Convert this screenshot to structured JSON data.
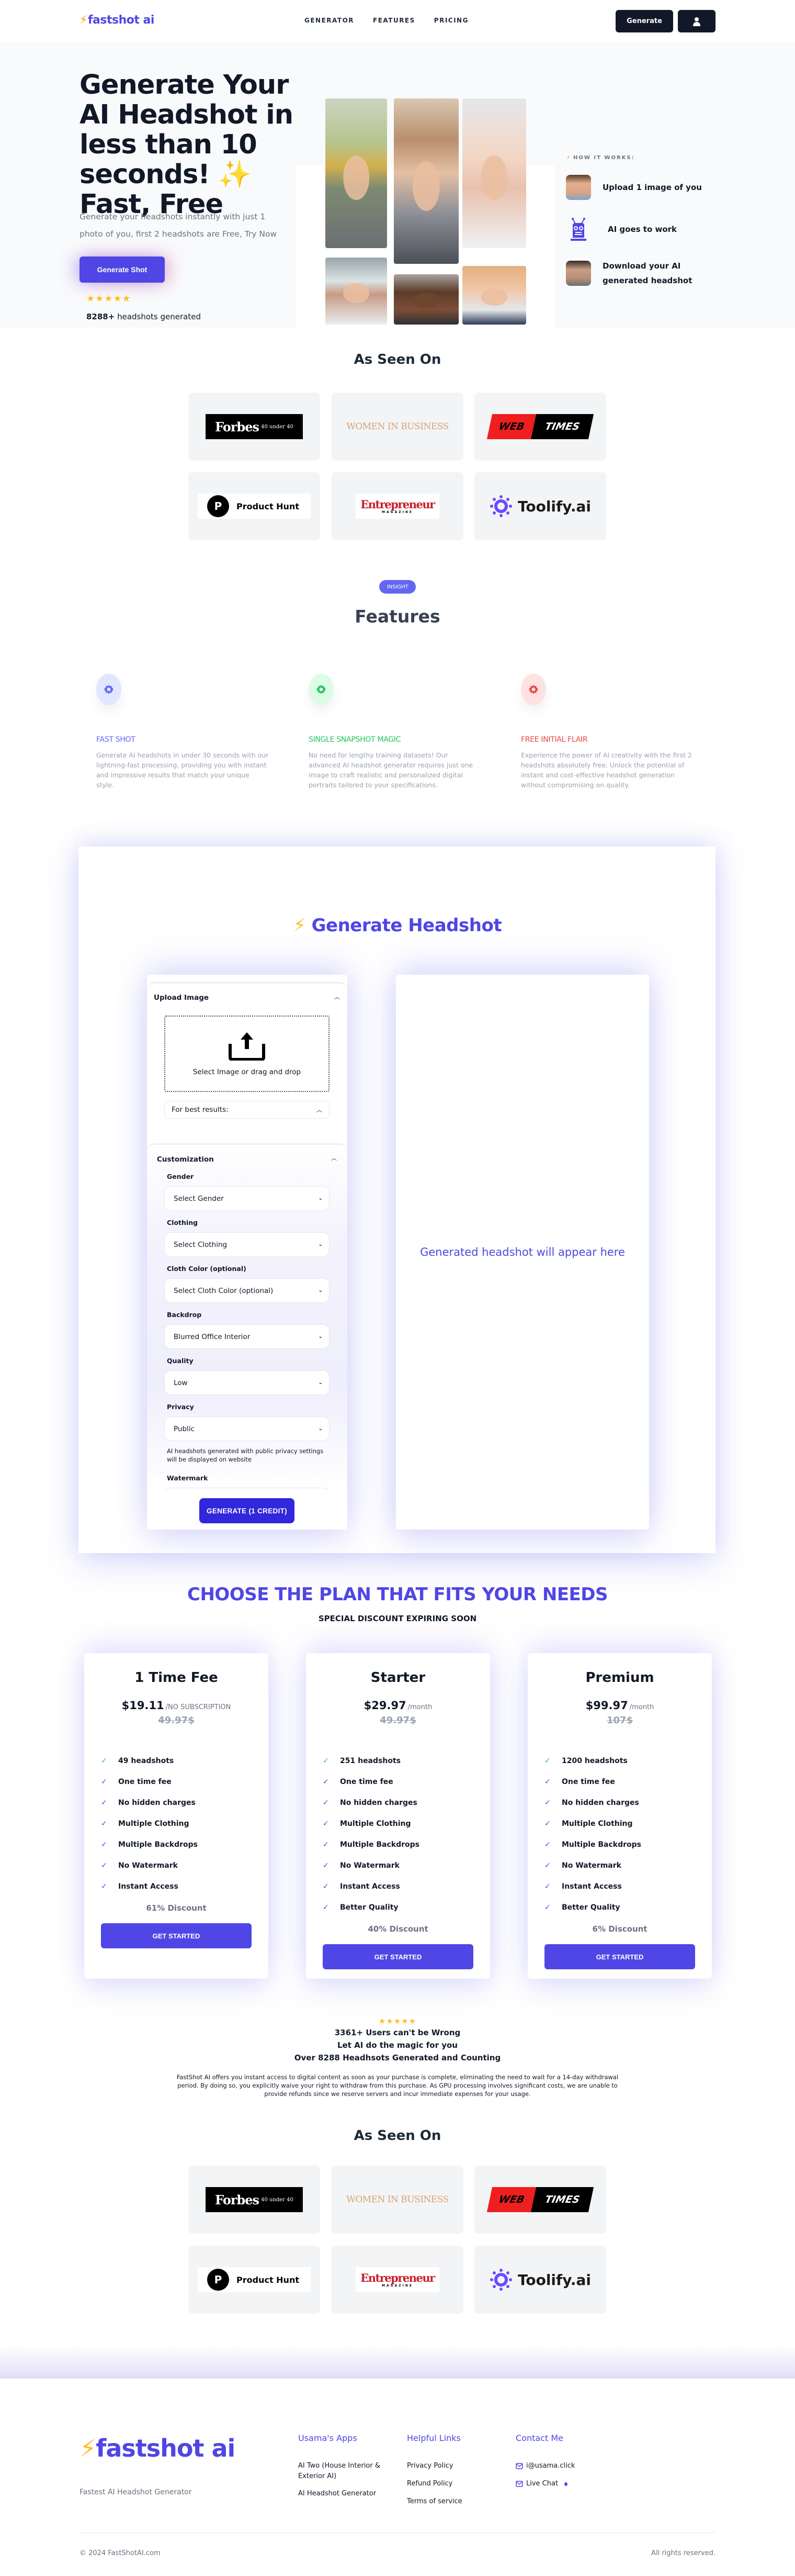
{
  "header": {
    "logo_text": "fastshot ai",
    "nav": [
      "GENERATOR",
      "FEATURES",
      "PRICING"
    ],
    "generate_button": "Generate",
    "user_icon": "user-icon"
  },
  "hero": {
    "title": "Generate Your AI Headshot in less than 10 seconds! ✨ Fast, Free",
    "subtitle": "Generate your headshots instantly with just 1 photo of you, first 2 headshots are Free, Try Now",
    "cta": "Generate Shot",
    "rating_stars": 5,
    "stars_text": "★★★★★",
    "count_bold": "8288+",
    "count_text": " headshots generated",
    "how_it_works_label": "HOW IT WORKS:",
    "steps": [
      {
        "text": "Upload 1 image of you",
        "icon": "face-photo"
      },
      {
        "text": "AI goes to work",
        "icon": "robot-icon"
      },
      {
        "text": "Download your AI generated headshot",
        "icon": "headshot-photo"
      }
    ]
  },
  "as_seen_on": {
    "title": "As Seen On",
    "logos": [
      {
        "name": "Forbes",
        "sub": "40 under 40"
      },
      {
        "name": "WOMEN IN BUSINESS"
      },
      {
        "name": "WEB",
        "sub": "TIMES"
      },
      {
        "name": "Product Hunt",
        "mark": "P"
      },
      {
        "name": "Entrepreneur",
        "sub": "MAGAZINE"
      },
      {
        "name": "Toolify.ai"
      }
    ]
  },
  "features": {
    "badge": "INSIGHT",
    "title": "Features",
    "items": [
      {
        "title": "FAST SHOT",
        "color": "#6366f1",
        "bg": "#e0e7ff",
        "desc": "Generate AI headshots in under 30 seconds with our lightning-fast processing, providing you with instant and impressive results that match your unique style."
      },
      {
        "title": "SINGLE SNAPSHOT MAGIC",
        "color": "#22c55e",
        "bg": "#dcfce7",
        "desc": "No need for lengthy training datasets! Our advanced AI headshot generator requires just one image to craft realistic and personalized digital portraits tailored to your specifications."
      },
      {
        "title": "FREE INITIAL FLAIR",
        "color": "#ef4444",
        "bg": "#fee2e2",
        "desc": "Experience the power of AI creativity with the first 2 headshots absolutely free. Unlock the potential of instant and cost-effective headshot generation without compromising on quality."
      }
    ]
  },
  "generator": {
    "title": "Generate Headshot",
    "upload_section": "Upload Image",
    "dropzone_text": "Select Image or drag and drop",
    "tips_label": "For best results:",
    "customization_section": "Customization",
    "fields": [
      {
        "label": "Gender",
        "value": "Select Gender"
      },
      {
        "label": "Clothing",
        "value": "Select Clothing"
      },
      {
        "label": "Cloth Color (optional)",
        "value": "Select Cloth Color (optional)"
      },
      {
        "label": "Backdrop",
        "value": "Blurred Office Interior"
      },
      {
        "label": "Quality",
        "value": "Low"
      },
      {
        "label": "Privacy",
        "value": "Public"
      }
    ],
    "privacy_note": "AI headshots generated with public privacy settings will be displayed on website",
    "watermark_label": "Watermark",
    "generate_button": "GENERATE (1 CREDIT)",
    "result_placeholder": "Generated headshot will appear here"
  },
  "pricing": {
    "title": "CHOOSE THE PLAN THAT FITS YOUR NEEDS",
    "subtitle": "SPECIAL DISCOUNT EXPIRING SOON",
    "plans": [
      {
        "name": "1 Time Fee",
        "price": "$19.11",
        "period": "/NO SUBSCRIPTION",
        "old_price": "49.97$",
        "features": [
          "49 headshots",
          "One time fee",
          "No hidden charges",
          "Multiple Clothing",
          "Multiple Backdrops",
          "No Watermark",
          "Instant Access"
        ],
        "discount": "61% Discount",
        "button": "GET STARTED"
      },
      {
        "name": "Starter",
        "price": "$29.97",
        "period": "/month",
        "old_price": "49.97$",
        "features": [
          "251 headshots",
          "One time fee",
          "No hidden charges",
          "Multiple Clothing",
          "Multiple Backdrops",
          "No Watermark",
          "Instant Access",
          "Better Quality"
        ],
        "discount": "40% Discount",
        "button": "GET STARTED"
      },
      {
        "name": "Premium",
        "price": "$99.97",
        "period": "/month",
        "old_price": "107$",
        "features": [
          "1200 headshots",
          "One time fee",
          "No hidden charges",
          "Multiple Clothing",
          "Multiple Backdrops",
          "No Watermark",
          "Instant Access",
          "Better Quality"
        ],
        "discount": "6% Discount",
        "button": "GET STARTED"
      }
    ]
  },
  "social_proof": {
    "stars_text": "★★★★★",
    "lines": [
      "3361+ Users can't be Wrong",
      "Let AI do the magic for you",
      "Over 8288 Headhsots Generated and Counting"
    ],
    "legal": "FastShot AI offers you instant access to digital content as soon as your purchase is complete, eliminating the need to wait for a 14-day withdrawal period. By doing so, you explicitly waive your right to withdraw from this purchase. As GPU processing involves significant costs, we are unable to provide refunds since we reserve servers and incur immediate expenses for your usage."
  },
  "footer": {
    "logo_text": "fastshot ai",
    "tagline": "Fastest AI Headshot Generator",
    "columns": [
      {
        "title": "Usama's Apps",
        "links": [
          "AI Two (House Interior & Exterior AI)",
          "AI Headshot Generator"
        ]
      },
      {
        "title": "Helpful Links",
        "links": [
          "Privacy Policy",
          "Refund Policy",
          "Terms of service"
        ]
      },
      {
        "title": "Contact Me",
        "links": [
          "i@usama.click",
          "Live Chat"
        ]
      }
    ],
    "copyright": "© 2024 FastShotAI.com",
    "rights": "All rights reserved."
  },
  "colors": {
    "brand": "#4f46e5",
    "accent_yellow": "#fbbf24",
    "dark": "#111827",
    "button_generate": "#3127dc"
  }
}
